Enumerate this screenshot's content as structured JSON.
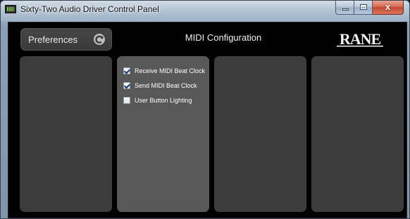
{
  "window": {
    "title": "Sixty-Two Audio Driver Control Panel",
    "icon": "mixer-app-icon",
    "controls": {
      "minimize_glyph": "",
      "maximize_glyph": "",
      "close_glyph": "x"
    }
  },
  "header": {
    "preferences_label": "Preferences",
    "preferences_icon": "refresh-icon",
    "title": "MIDI Configuration",
    "logo_text": "RANE"
  },
  "panels": {
    "options": [
      {
        "label": "Receive MIDI Beat Clock",
        "checked": true
      },
      {
        "label": "Send MIDI Beat Clock",
        "checked": true
      },
      {
        "label": "User Button Lighting",
        "checked": false
      }
    ]
  },
  "colors": {
    "client_bg": "#000000",
    "panel_bg": "#3c3c3c",
    "active_panel_bg": "#585858",
    "text": "#ffffff"
  }
}
